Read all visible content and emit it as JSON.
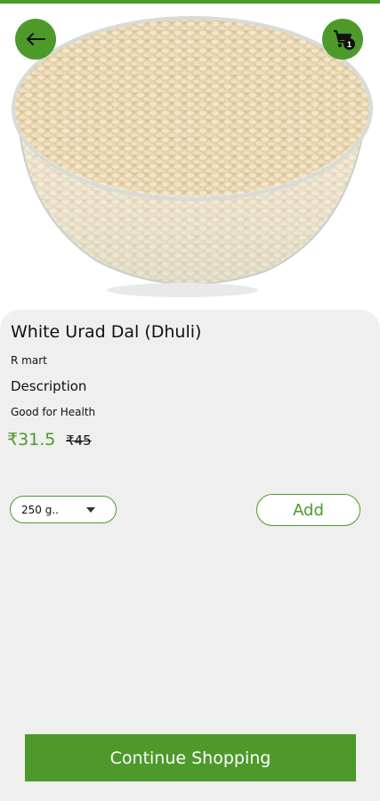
{
  "header": {
    "back_icon": "arrow-left-icon",
    "cart_icon": "cart-icon",
    "cart_count": "1"
  },
  "product": {
    "image": "bowl-of-urad-dal",
    "name": "White Urad Dal (Dhuli)",
    "brand": "R mart",
    "description_label": "Description",
    "description": "Good for Health",
    "price": "₹31.5",
    "mrp": "₹45"
  },
  "actions": {
    "quantity_selected": "250 g..",
    "add_label": "Add",
    "continue_label": "Continue Shopping"
  },
  "colors": {
    "accent": "#4d9a2a",
    "sheet_bg": "#efefef"
  }
}
